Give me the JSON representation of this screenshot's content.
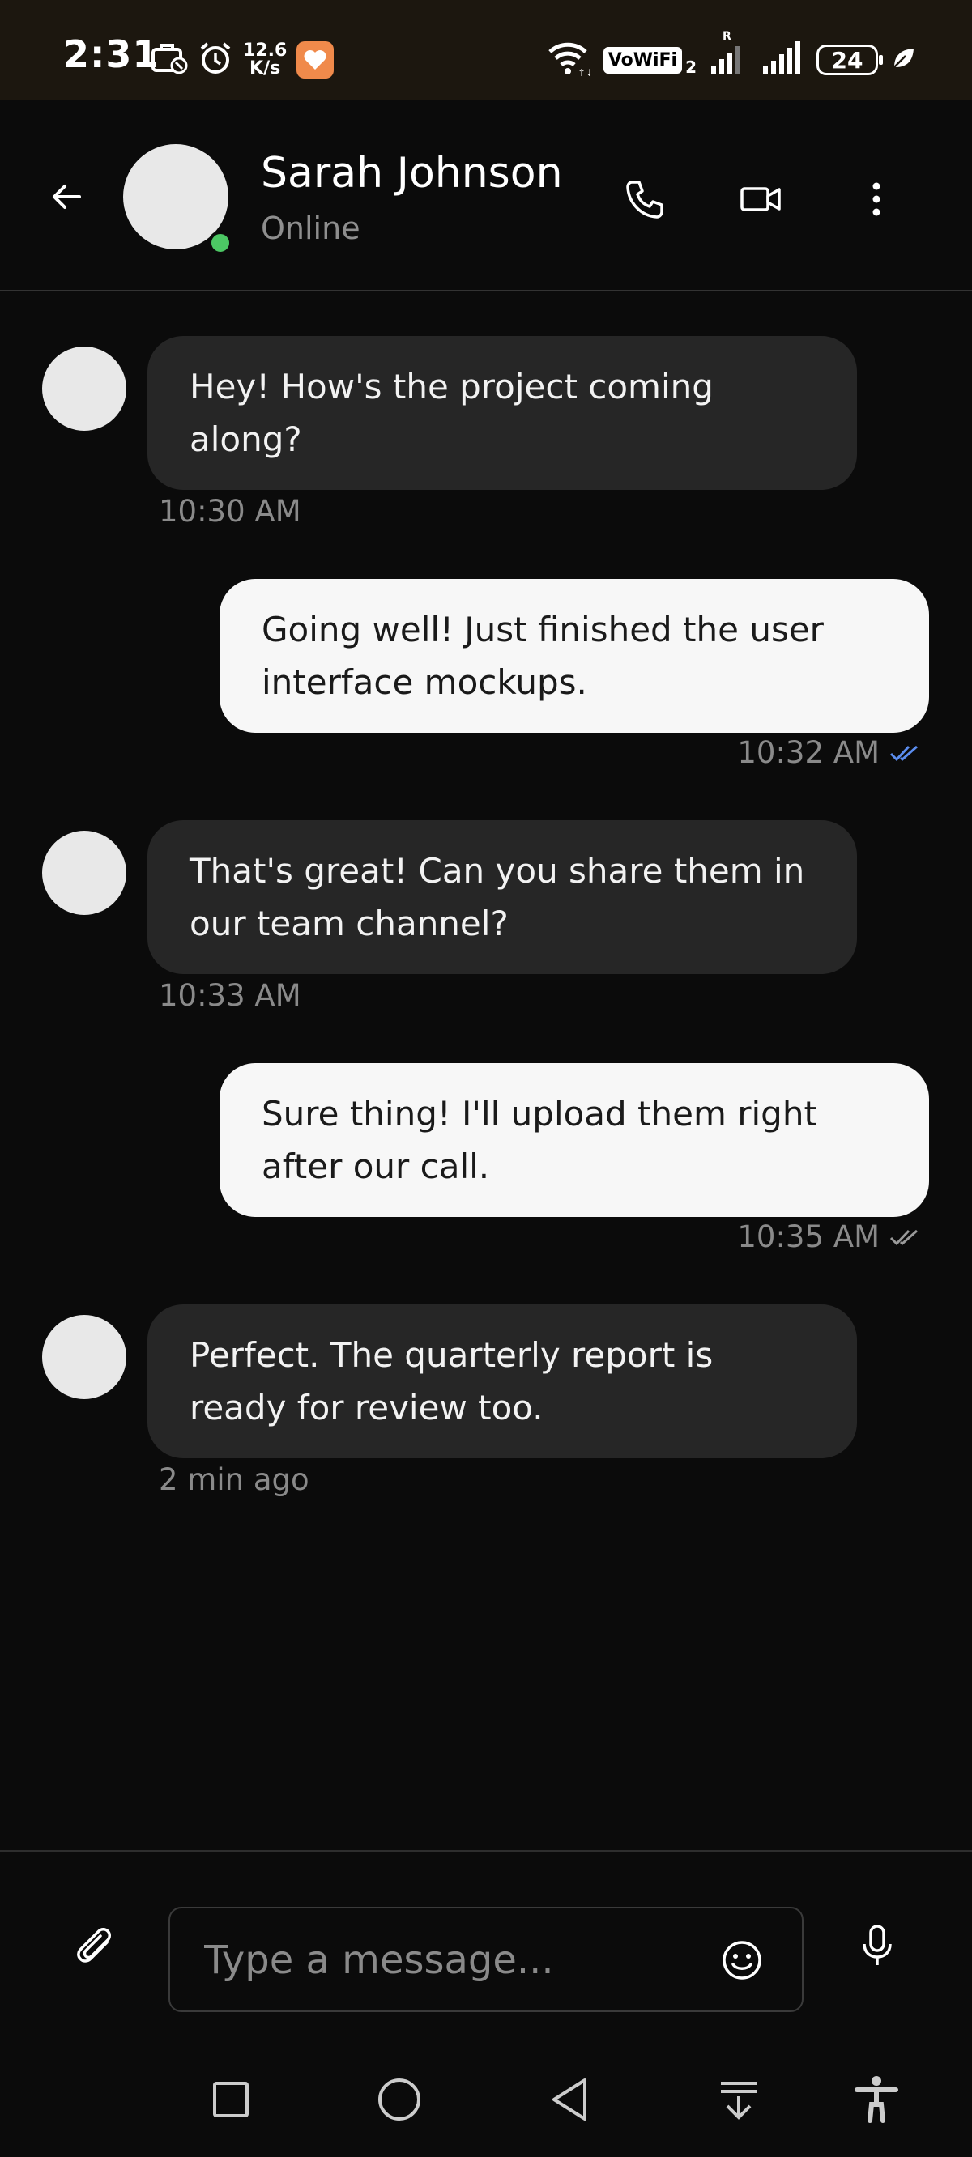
{
  "status_bar": {
    "time": "2:31",
    "net_speed_value": "12.6",
    "net_speed_unit": "K/s",
    "vowifi_label": "VoWiFi",
    "vowifi_sub": "2",
    "roaming_label": "R",
    "battery_level": "24"
  },
  "header": {
    "contact_name": "Sarah Johnson",
    "contact_status": "Online",
    "icons": [
      "back-arrow-icon",
      "phone-icon",
      "video-icon",
      "more-vert-icon"
    ]
  },
  "messages": [
    {
      "direction": "in",
      "line1": "Hey! How's the project coming",
      "line2": "along?",
      "time": "10:30 AM"
    },
    {
      "direction": "out",
      "line1": "Going well! Just finished the user",
      "line2": "interface mockups.",
      "time": "10:32 AM",
      "read": true
    },
    {
      "direction": "in",
      "line1": "That's great! Can you share them in",
      "line2": "our team channel?",
      "time": "10:33 AM"
    },
    {
      "direction": "out",
      "line1": "Sure thing! I'll upload them right",
      "line2": "after our call.",
      "time": "10:35 AM",
      "read": false
    },
    {
      "direction": "in",
      "line1": "Perfect. The quarterly report is",
      "line2": "ready for review too.",
      "time": "2 min ago"
    }
  ],
  "composer": {
    "placeholder": "Type a message...",
    "value": ""
  },
  "colors": {
    "background": "#0b0b0b",
    "incoming_bubble": "#262626",
    "outgoing_bubble": "#f7f7f7",
    "online": "#4cc764",
    "read_receipt": "#5b8def",
    "delivered_receipt": "#9a9a9a"
  }
}
